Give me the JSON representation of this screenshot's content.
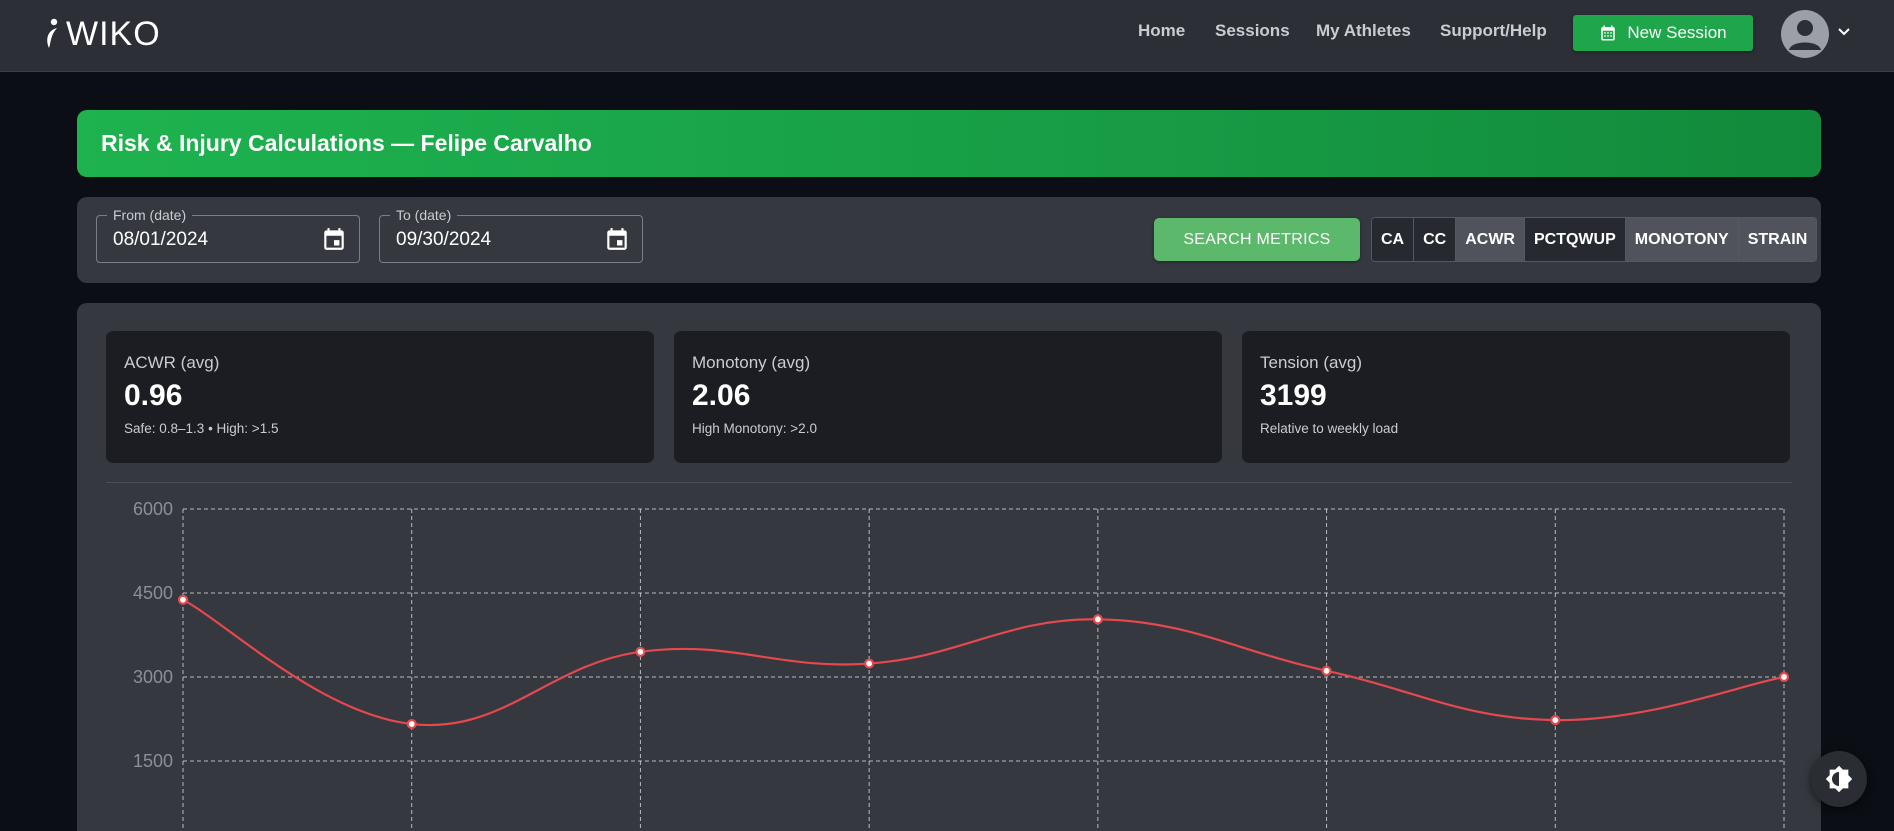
{
  "navbar": {
    "logo_text": "WIKO",
    "links": [
      {
        "label": "Home"
      },
      {
        "label": "Sessions"
      },
      {
        "label": "My Athletes"
      },
      {
        "label": "Support/Help"
      }
    ],
    "new_session_label": "New Session"
  },
  "banner": {
    "title": "Risk & Injury Calculations — Felipe Carvalho"
  },
  "filters": {
    "from_label": "From (date)",
    "from_value": "08/01/2024",
    "to_label": "To (date)",
    "to_value": "09/30/2024",
    "search_label": "SEARCH METRICS",
    "toggles": [
      {
        "label": "CA",
        "active": false
      },
      {
        "label": "CC",
        "active": false
      },
      {
        "label": "ACWR",
        "active": true
      },
      {
        "label": "PCTQWUP",
        "active": false
      },
      {
        "label": "MONOTONY",
        "active": true
      },
      {
        "label": "STRAIN",
        "active": true
      }
    ]
  },
  "stats": [
    {
      "label": "ACWR (avg)",
      "value": "0.96",
      "note": "Safe: 0.8–1.3 • High: >1.5"
    },
    {
      "label": "Monotony (avg)",
      "value": "2.06",
      "note": "High Monotony: >2.0"
    },
    {
      "label": "Tension (avg)",
      "value": "3199",
      "note": "Relative to weekly load"
    }
  ],
  "chart_data": {
    "type": "line",
    "ytick_labels": [
      "6000",
      "4500",
      "3000",
      "1500"
    ],
    "ylim": [
      0,
      6000
    ],
    "grid": true,
    "series": [
      {
        "color": "#e5484d",
        "values": [
          4380,
          2160,
          3450,
          3240,
          4030,
          3110,
          2230,
          3000
        ]
      }
    ]
  },
  "colors": {
    "accent_green": "#1fa64a",
    "line_red": "#e5484d",
    "card_bg": "#35383f",
    "page_bg": "#0b0e14"
  }
}
